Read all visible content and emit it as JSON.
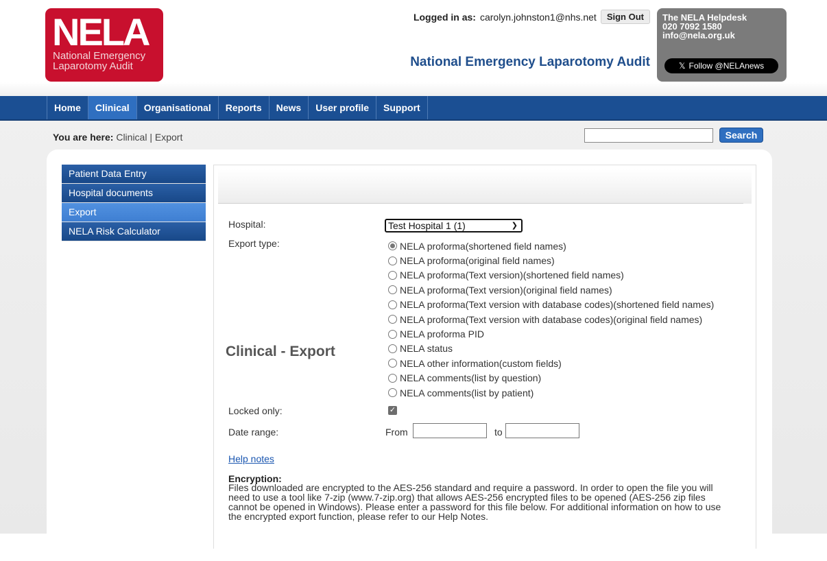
{
  "logo": {
    "wordmark": "NELA",
    "line1": "National Emergency",
    "line2": "Laparotomy Audit"
  },
  "header": {
    "logged_in_label": "Logged in as:",
    "user_email": "carolyn.johnston1@nhs.net",
    "sign_out_label": "Sign Out",
    "site_title": "National Emergency Laparotomy Audit"
  },
  "helpdesk": {
    "title": "The NELA Helpdesk",
    "phone": "020 7092 1580",
    "email": "info@nela.org.uk",
    "follow_label": "Follow @NELAnews"
  },
  "nav": {
    "items": [
      {
        "label": "Home"
      },
      {
        "label": "Clinical",
        "active": true
      },
      {
        "label": "Organisational"
      },
      {
        "label": "Reports"
      },
      {
        "label": "News"
      },
      {
        "label": "User profile"
      },
      {
        "label": "Support"
      }
    ]
  },
  "breadcrumb": {
    "label": "You are here:",
    "path": "Clinical | Export"
  },
  "search": {
    "value": "",
    "button_label": "Search"
  },
  "sidebar": {
    "items": [
      {
        "label": "Patient Data Entry"
      },
      {
        "label": "Hospital documents"
      },
      {
        "label": "Export",
        "active": true
      },
      {
        "label": "NELA Risk Calculator"
      }
    ]
  },
  "main": {
    "title": "Clinical - Export",
    "hospital_label": "Hospital:",
    "hospital_value": "Test Hospital 1 (1)",
    "export_type_label": "Export type:",
    "export_types": [
      {
        "label": "NELA proforma(shortened field names)",
        "selected": true
      },
      {
        "label": "NELA proforma(original field names)",
        "selected": false
      },
      {
        "label": "NELA proforma(Text version)(shortened field names)",
        "selected": false
      },
      {
        "label": "NELA proforma(Text version)(original field names)",
        "selected": false
      },
      {
        "label": "NELA proforma(Text version with database codes)(shortened field names)",
        "selected": false
      },
      {
        "label": "NELA proforma(Text version with database codes)(original field names)",
        "selected": false
      },
      {
        "label": "NELA proforma PID",
        "selected": false
      },
      {
        "label": "NELA status",
        "selected": false
      },
      {
        "label": "NELA other information(custom fields)",
        "selected": false
      },
      {
        "label": "NELA comments(list by question)",
        "selected": false
      },
      {
        "label": "NELA comments(list by patient)",
        "selected": false
      }
    ],
    "locked_only_label": "Locked only:",
    "locked_only_checked": true,
    "date_range_label": "Date range:",
    "from_label": "From",
    "to_label": "to",
    "from_value": "",
    "to_value": "",
    "help_link": "Help notes",
    "encryption_title": "Encryption:",
    "encryption_text": "Files downloaded are encrypted to the AES-256 standard and require a password. In order to open the file you will need to use a tool like 7-zip (www.7-zip.org) that allows AES-256 encrypted files to be opened (AES-256 zip files cannot be opened in Windows). Please enter a password for this file below. For additional information on how to use the encrypted export function, please refer to our Help Notes."
  },
  "colors": {
    "brand_red": "#c8102e",
    "nav_blue": "#1b4f93",
    "active_blue": "#2f6fc0",
    "title_blue": "#1f4e8c"
  }
}
